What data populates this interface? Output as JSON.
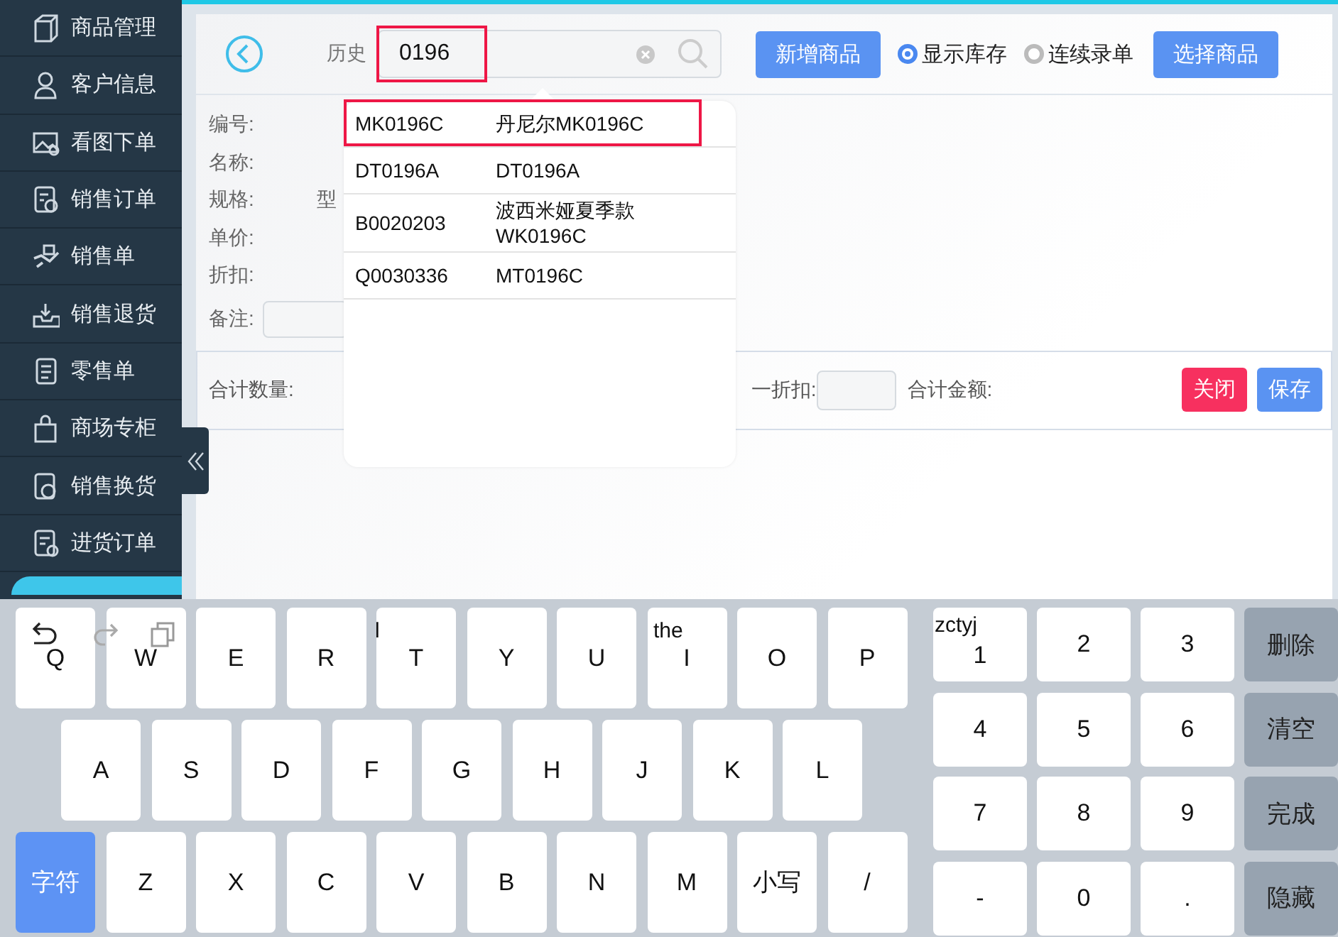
{
  "sidebar": {
    "items": [
      {
        "label": "商品管理",
        "selected": false
      },
      {
        "label": "客户信息",
        "selected": false
      },
      {
        "label": "看图下单",
        "selected": false
      },
      {
        "label": "销售订单",
        "selected": false
      },
      {
        "label": "销售单",
        "selected": false
      },
      {
        "label": "销售退货",
        "selected": false
      },
      {
        "label": "零售单",
        "selected": false
      },
      {
        "label": "商场专柜",
        "selected": false
      },
      {
        "label": "销售换货",
        "selected": false
      },
      {
        "label": "进货订单",
        "selected": false
      },
      {
        "selected": true
      }
    ]
  },
  "toolbar": {
    "history": "历史",
    "search": {
      "value": "0196",
      "highlighted": true
    },
    "add_button": "新增商品",
    "options": [
      {
        "label": "显示库存",
        "checked": true
      },
      {
        "label": "连续录单",
        "checked": false
      }
    ],
    "select_button": "选择商品"
  },
  "form": {
    "fields": [
      {
        "label": "编号:"
      },
      {
        "label": "名称:"
      },
      {
        "label": "规格:",
        "extra": "型"
      },
      {
        "label": "单价:"
      },
      {
        "label": "折扣:"
      }
    ],
    "remark_label": "备注:"
  },
  "summary": {
    "total_qty_label": "合计数量:",
    "discount_label": "一折扣:",
    "total_amount_label": "合计金额:",
    "buttons": [
      {
        "label": "关闭",
        "kind": "danger"
      },
      {
        "label": "保存",
        "kind": "primary"
      }
    ]
  },
  "dropdown": {
    "rows": [
      {
        "code": "MK0196C",
        "name": "丹尼尔MK0196C",
        "highlighted": true
      },
      {
        "code": "DT0196A",
        "name": "DT0196A",
        "highlighted": false
      },
      {
        "code": "B0020203",
        "name": "波西米娅夏季款WK0196C",
        "highlighted": false
      },
      {
        "code": "Q0030336",
        "name": "MT0196C",
        "highlighted": false
      }
    ]
  },
  "keyboard": {
    "rows": [
      [
        "Q",
        "W",
        "E",
        "R",
        "T",
        "Y",
        "U",
        "I",
        "O",
        "P"
      ],
      [
        "A",
        "S",
        "D",
        "F",
        "G",
        "H",
        "J",
        "K",
        "L"
      ],
      [
        {
          "label": "字符",
          "kind": "mode"
        },
        "Z",
        "X",
        "C",
        "V",
        "B",
        "N",
        "M",
        "小写",
        "/"
      ]
    ],
    "numpad": [
      [
        "1",
        "2",
        "3"
      ],
      [
        "4",
        "5",
        "6"
      ],
      [
        "7",
        "8",
        "9"
      ],
      [
        "-",
        "0",
        "."
      ]
    ],
    "actions": [
      "删除",
      "清空",
      "完成",
      "隐藏"
    ],
    "suggestions": [
      "l",
      "the",
      "zctyj"
    ]
  }
}
